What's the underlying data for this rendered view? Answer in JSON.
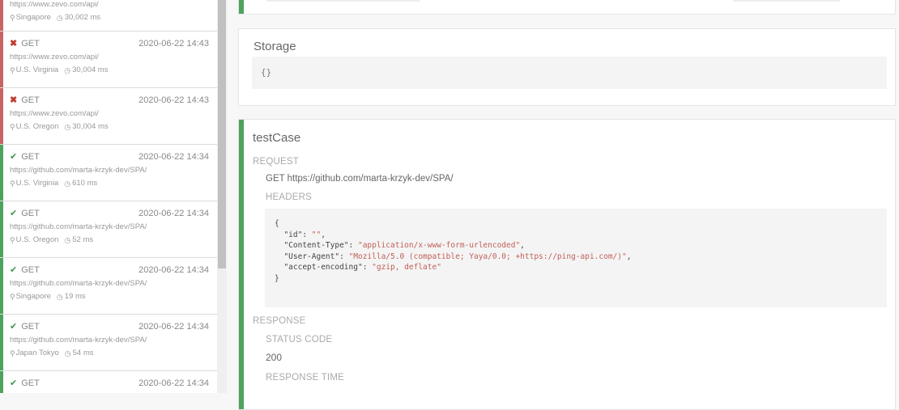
{
  "requests": [
    {
      "url": "https://www.zevo.com/api/",
      "location": "Singapore",
      "duration": "30,002 ms"
    },
    {
      "status": "fail",
      "method": "GET",
      "time": "2020-06-22 14:43",
      "url": "https://www.zevo.com/api/",
      "location": "U.S. Virginia",
      "duration": "30,004 ms"
    },
    {
      "status": "fail",
      "method": "GET",
      "time": "2020-06-22 14:43",
      "url": "https://www.zevo.com/api/",
      "location": "U.S. Oregon",
      "duration": "30,004 ms"
    },
    {
      "status": "ok",
      "method": "GET",
      "time": "2020-06-22 14:34",
      "url": "https://github.com/marta-krzyk-dev/SPA/",
      "location": "U.S. Virginia",
      "duration": "610 ms"
    },
    {
      "status": "ok",
      "method": "GET",
      "time": "2020-06-22 14:34",
      "url": "https://github.com/marta-krzyk-dev/SPA/",
      "location": "U.S. Oregon",
      "duration": "52 ms"
    },
    {
      "status": "ok",
      "method": "GET",
      "time": "2020-06-22 14:34",
      "url": "https://github.com/marta-krzyk-dev/SPA/",
      "location": "Singapore",
      "duration": "19 ms"
    },
    {
      "status": "ok",
      "method": "GET",
      "time": "2020-06-22 14:34",
      "url": "https://github.com/marta-krzyk-dev/SPA/",
      "location": "Japan Tokyo",
      "duration": "54 ms"
    },
    {
      "status": "ok",
      "method": "GET",
      "time": "2020-06-22 14:34"
    }
  ],
  "icons": {
    "fail": "x-icon",
    "ok": "check-icon",
    "location": "location-pin-icon",
    "duration": "clock-icon"
  },
  "colors": {
    "fail": "#c86464",
    "ok": "#4ea35c"
  },
  "storage": {
    "title": "Storage",
    "value": "{}"
  },
  "testcase": {
    "title": "testCase",
    "request_label": "REQUEST",
    "request_line": "GET https://github.com/marta-krzyk-dev/SPA/",
    "headers_label": "HEADERS",
    "headers": [
      {
        "key": "\"id\"",
        "value": "\"\""
      },
      {
        "key": "\"Content-Type\"",
        "value": "\"application/x-www-form-urlencoded\""
      },
      {
        "key": "\"User-Agent\"",
        "value": "\"Mozilla/5.0 (compatible; Yaya/0.0; +https://ping-api.com/)\""
      },
      {
        "key": "\"accept-encoding\"",
        "value": "\"gzip, deflate\""
      }
    ],
    "response_label": "RESPONSE",
    "status_code_label": "STATUS CODE",
    "status_code": "200",
    "response_time_label": "RESPONSE TIME"
  }
}
